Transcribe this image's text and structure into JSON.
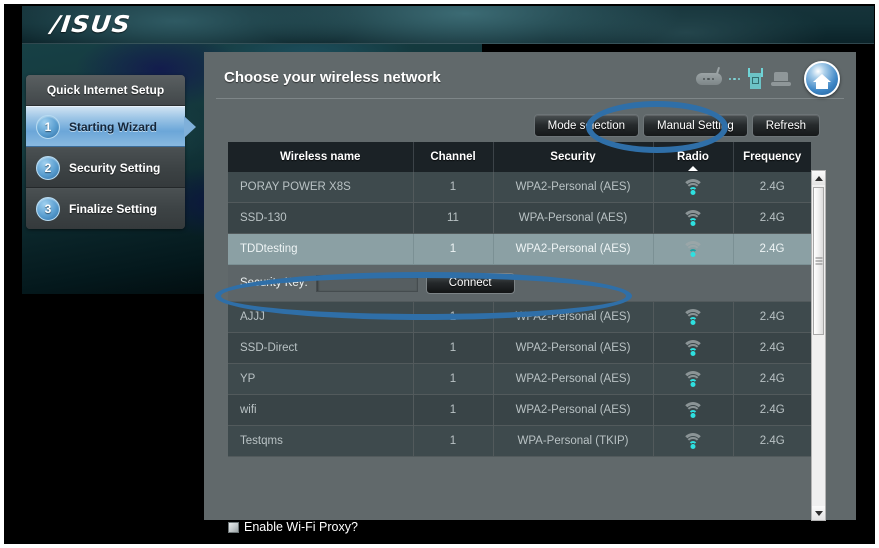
{
  "brand": {
    "logo_text": "/ISUS"
  },
  "sidebar": {
    "title": "Quick Internet Setup",
    "items": [
      {
        "num": "1",
        "label": "Starting Wizard",
        "active": true
      },
      {
        "num": "2",
        "label": "Security Setting",
        "active": false
      },
      {
        "num": "3",
        "label": "Finalize Setting",
        "active": false
      }
    ]
  },
  "main": {
    "title": "Choose your wireless network",
    "buttons": {
      "mode_selection": "Mode selection",
      "manual_setting": "Manual Setting",
      "refresh": "Refresh"
    },
    "icons": {
      "router": "router-icon",
      "access_point": "access-point-icon",
      "laptop": "laptop-icon",
      "home": "home-icon"
    }
  },
  "table": {
    "columns": [
      "Wireless name",
      "Channel",
      "Security",
      "Radio",
      "Frequency"
    ],
    "sorted_column": "Radio",
    "sort_direction": "asc",
    "rows": [
      {
        "name": "PORAY POWER X8S",
        "channel": "1",
        "security": "WPA2-Personal (AES)",
        "radio": "wifi-signal-icon",
        "frequency": "2.4G",
        "selected": false,
        "signal": "strong"
      },
      {
        "name": "SSD-130",
        "channel": "11",
        "security": "WPA-Personal (AES)",
        "radio": "wifi-signal-icon",
        "frequency": "2.4G",
        "selected": false,
        "signal": "strong"
      },
      {
        "name": "TDDtesting",
        "channel": "1",
        "security": "WPA2-Personal (AES)",
        "radio": "wifi-signal-icon",
        "frequency": "2.4G",
        "selected": true,
        "signal": "weak"
      },
      {
        "name": "AJJJ",
        "channel": "1",
        "security": "WPA2-Personal (AES)",
        "radio": "wifi-signal-icon",
        "frequency": "2.4G",
        "selected": false,
        "signal": "strong"
      },
      {
        "name": "SSD-Direct",
        "channel": "1",
        "security": "WPA2-Personal (AES)",
        "radio": "wifi-signal-icon",
        "frequency": "2.4G",
        "selected": false,
        "signal": "strong"
      },
      {
        "name": "YP",
        "channel": "1",
        "security": "WPA2-Personal (AES)",
        "radio": "wifi-signal-icon",
        "frequency": "2.4G",
        "selected": false,
        "signal": "strong"
      },
      {
        "name": "wifi",
        "channel": "1",
        "security": "WPA2-Personal (AES)",
        "radio": "wifi-signal-icon",
        "frequency": "2.4G",
        "selected": false,
        "signal": "strong"
      },
      {
        "name": "Testqms",
        "channel": "1",
        "security": "WPA-Personal (TKIP)",
        "radio": "wifi-signal-icon",
        "frequency": "2.4G",
        "selected": false,
        "signal": "strong"
      }
    ]
  },
  "security_key": {
    "label": "Security Key:",
    "value": "",
    "placeholder": "",
    "connect_label": "Connect"
  },
  "proxy": {
    "label": "Enable Wi-Fi Proxy?",
    "checked": false
  },
  "annotations": {
    "color": "#2f6fa8",
    "shapes": [
      "manual-setting-highlight",
      "security-key-row-highlight"
    ]
  }
}
